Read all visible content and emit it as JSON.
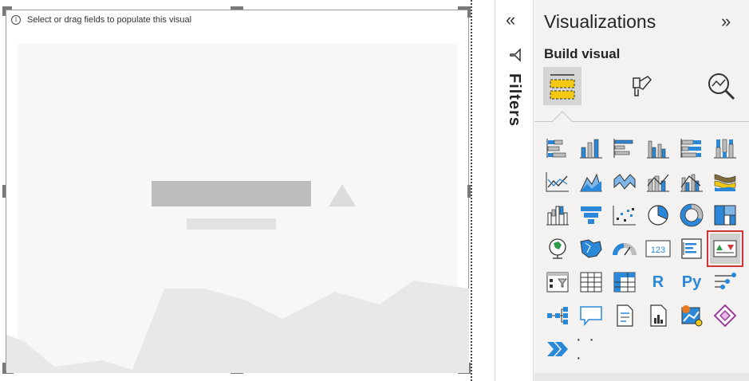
{
  "canvas": {
    "hint_text": "Select or drag fields to populate this visual",
    "info_icon_glyph": "i"
  },
  "filters_pane": {
    "collapse_glyph": "«",
    "label": "Filters"
  },
  "visualizations_pane": {
    "title": "Visualizations",
    "expand_glyph": "»",
    "subtitle": "Build visual",
    "tabs": [
      {
        "name": "fields-tab",
        "icon": "fields-icon",
        "active": true
      },
      {
        "name": "format-tab",
        "icon": "paintbrush-icon",
        "active": false
      },
      {
        "name": "analytics-tab",
        "icon": "analytics-magnifier-icon",
        "active": false
      }
    ],
    "visual_types": [
      "stacked-bar-chart",
      "stacked-column-chart",
      "clustered-bar-chart",
      "clustered-column-chart",
      "100-stacked-bar-chart",
      "100-stacked-column-chart",
      "line-chart",
      "area-chart",
      "stacked-area-chart",
      "line-and-stacked-column-chart",
      "line-and-clustered-column-chart",
      "ribbon-chart",
      "waterfall-chart",
      "funnel-chart",
      "scatter-chart",
      "pie-chart",
      "donut-chart",
      "treemap",
      "map",
      "filled-map",
      "gauge",
      "card",
      "multi-row-card",
      "kpi",
      "slicer",
      "table",
      "matrix",
      "r-script-visual",
      "python-visual",
      "key-influencers",
      "decomposition-tree",
      "qa-visual",
      "smart-narrative",
      "paginated-report",
      "arcgis-map",
      "power-apps",
      "power-automate",
      "more-visuals"
    ],
    "r_label": "R",
    "py_label": "Py",
    "more_label": "· · ·",
    "selected_visual": "kpi",
    "colors": {
      "accent_blue": "#2b88d8",
      "accent_yellow": "#f2c811",
      "selection_red": "#d13438",
      "kpi_green": "#2e9c4a",
      "kpi_red": "#d13438"
    }
  }
}
